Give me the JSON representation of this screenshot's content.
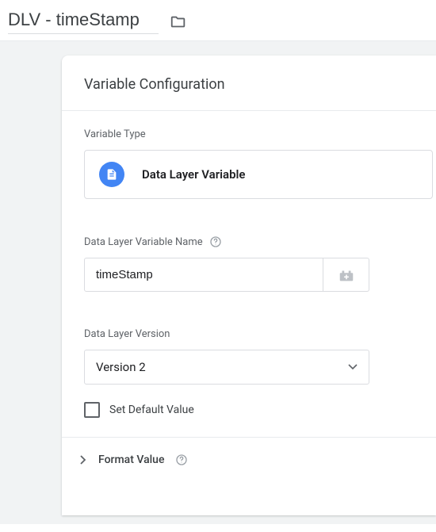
{
  "header": {
    "title_value": "DLV - timeStamp"
  },
  "card": {
    "title": "Variable Configuration",
    "variable_type": {
      "label": "Variable Type",
      "selected": "Data Layer Variable"
    },
    "dlv_name": {
      "label": "Data Layer Variable Name",
      "value": "timeStamp"
    },
    "dlv_version": {
      "label": "Data Layer Version",
      "selected": "Version 2"
    },
    "set_default": {
      "label": "Set Default Value"
    },
    "format_value": {
      "label": "Format Value"
    }
  }
}
